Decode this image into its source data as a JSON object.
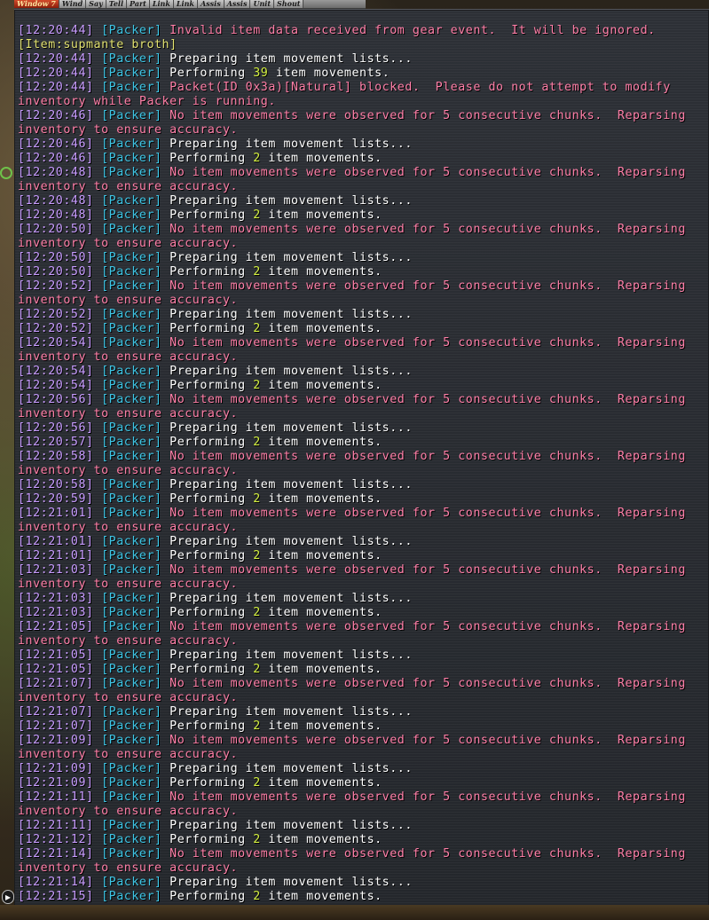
{
  "tabs": [
    "Window 7",
    "Wind",
    "Say",
    "Tell",
    "Part",
    "Link",
    "Link",
    "Assis",
    "Assis",
    "Unit",
    "Shout"
  ],
  "lines": [
    {
      "ts": "[12:20:44]",
      "tag": "[Packer]",
      "parts": [
        {
          "t": " Invalid item data received from gear event.  It will be ignored.",
          "c": "pink"
        }
      ]
    },
    {
      "ts": "",
      "tag": "",
      "parts": [
        {
          "t": "[Item:supmante broth]",
          "c": "item"
        }
      ]
    },
    {
      "ts": "[12:20:44]",
      "tag": "[Packer]",
      "parts": [
        {
          "t": " Preparing item movement lists...",
          "c": "white"
        }
      ]
    },
    {
      "ts": "[12:20:44]",
      "tag": "[Packer]",
      "parts": [
        {
          "t": " Performing ",
          "c": "white"
        },
        {
          "t": "39",
          "c": "num"
        },
        {
          "t": " item movements.",
          "c": "white"
        }
      ]
    },
    {
      "ts": "[12:20:44]",
      "tag": "[Packer]",
      "parts": [
        {
          "t": " Packet(ID 0x3a)[Natural] blocked.  Please do not attempt to modify",
          "c": "pink"
        }
      ]
    },
    {
      "ts": "",
      "tag": "",
      "parts": [
        {
          "t": "inventory while Packer is running.",
          "c": "pink"
        }
      ]
    },
    {
      "ts": "[12:20:46]",
      "tag": "[Packer]",
      "parts": [
        {
          "t": " No item movements were observed for 5 consecutive chunks.  Reparsing",
          "c": "pink"
        }
      ]
    },
    {
      "ts": "",
      "tag": "",
      "parts": [
        {
          "t": "inventory to ensure accuracy.",
          "c": "pink"
        }
      ]
    },
    {
      "ts": "[12:20:46]",
      "tag": "[Packer]",
      "parts": [
        {
          "t": " Preparing item movement lists...",
          "c": "white"
        }
      ]
    },
    {
      "ts": "[12:20:46]",
      "tag": "[Packer]",
      "parts": [
        {
          "t": " Performing ",
          "c": "white"
        },
        {
          "t": "2",
          "c": "num"
        },
        {
          "t": " item movements.",
          "c": "white"
        }
      ]
    },
    {
      "ts": "[12:20:48]",
      "tag": "[Packer]",
      "parts": [
        {
          "t": " No item movements were observed for 5 consecutive chunks.  Reparsing",
          "c": "pink"
        }
      ]
    },
    {
      "ts": "",
      "tag": "",
      "parts": [
        {
          "t": "inventory to ensure accuracy.",
          "c": "pink"
        }
      ]
    },
    {
      "ts": "[12:20:48]",
      "tag": "[Packer]",
      "parts": [
        {
          "t": " Preparing item movement lists...",
          "c": "white"
        }
      ]
    },
    {
      "ts": "[12:20:48]",
      "tag": "[Packer]",
      "parts": [
        {
          "t": " Performing ",
          "c": "white"
        },
        {
          "t": "2",
          "c": "num"
        },
        {
          "t": " item movements.",
          "c": "white"
        }
      ]
    },
    {
      "ts": "[12:20:50]",
      "tag": "[Packer]",
      "parts": [
        {
          "t": " No item movements were observed for 5 consecutive chunks.  Reparsing",
          "c": "pink"
        }
      ]
    },
    {
      "ts": "",
      "tag": "",
      "parts": [
        {
          "t": "inventory to ensure accuracy.",
          "c": "pink"
        }
      ]
    },
    {
      "ts": "[12:20:50]",
      "tag": "[Packer]",
      "parts": [
        {
          "t": " Preparing item movement lists...",
          "c": "white"
        }
      ]
    },
    {
      "ts": "[12:20:50]",
      "tag": "[Packer]",
      "parts": [
        {
          "t": " Performing ",
          "c": "white"
        },
        {
          "t": "2",
          "c": "num"
        },
        {
          "t": " item movements.",
          "c": "white"
        }
      ]
    },
    {
      "ts": "[12:20:52]",
      "tag": "[Packer]",
      "parts": [
        {
          "t": " No item movements were observed for 5 consecutive chunks.  Reparsing",
          "c": "pink"
        }
      ]
    },
    {
      "ts": "",
      "tag": "",
      "parts": [
        {
          "t": "inventory to ensure accuracy.",
          "c": "pink"
        }
      ]
    },
    {
      "ts": "[12:20:52]",
      "tag": "[Packer]",
      "parts": [
        {
          "t": " Preparing item movement lists...",
          "c": "white"
        }
      ]
    },
    {
      "ts": "[12:20:52]",
      "tag": "[Packer]",
      "parts": [
        {
          "t": " Performing ",
          "c": "white"
        },
        {
          "t": "2",
          "c": "num"
        },
        {
          "t": " item movements.",
          "c": "white"
        }
      ]
    },
    {
      "ts": "[12:20:54]",
      "tag": "[Packer]",
      "parts": [
        {
          "t": " No item movements were observed for 5 consecutive chunks.  Reparsing",
          "c": "pink"
        }
      ]
    },
    {
      "ts": "",
      "tag": "",
      "parts": [
        {
          "t": "inventory to ensure accuracy.",
          "c": "pink"
        }
      ]
    },
    {
      "ts": "[12:20:54]",
      "tag": "[Packer]",
      "parts": [
        {
          "t": " Preparing item movement lists...",
          "c": "white"
        }
      ]
    },
    {
      "ts": "[12:20:54]",
      "tag": "[Packer]",
      "parts": [
        {
          "t": " Performing ",
          "c": "white"
        },
        {
          "t": "2",
          "c": "num"
        },
        {
          "t": " item movements.",
          "c": "white"
        }
      ]
    },
    {
      "ts": "[12:20:56]",
      "tag": "[Packer]",
      "parts": [
        {
          "t": " No item movements were observed for 5 consecutive chunks.  Reparsing",
          "c": "pink"
        }
      ]
    },
    {
      "ts": "",
      "tag": "",
      "parts": [
        {
          "t": "inventory to ensure accuracy.",
          "c": "pink"
        }
      ]
    },
    {
      "ts": "[12:20:56]",
      "tag": "[Packer]",
      "parts": [
        {
          "t": " Preparing item movement lists...",
          "c": "white"
        }
      ]
    },
    {
      "ts": "[12:20:57]",
      "tag": "[Packer]",
      "parts": [
        {
          "t": " Performing ",
          "c": "white"
        },
        {
          "t": "2",
          "c": "num"
        },
        {
          "t": " item movements.",
          "c": "white"
        }
      ]
    },
    {
      "ts": "[12:20:58]",
      "tag": "[Packer]",
      "parts": [
        {
          "t": " No item movements were observed for 5 consecutive chunks.  Reparsing",
          "c": "pink"
        }
      ]
    },
    {
      "ts": "",
      "tag": "",
      "parts": [
        {
          "t": "inventory to ensure accuracy.",
          "c": "pink"
        }
      ]
    },
    {
      "ts": "[12:20:58]",
      "tag": "[Packer]",
      "parts": [
        {
          "t": " Preparing item movement lists...",
          "c": "white"
        }
      ]
    },
    {
      "ts": "[12:20:59]",
      "tag": "[Packer]",
      "parts": [
        {
          "t": " Performing ",
          "c": "white"
        },
        {
          "t": "2",
          "c": "num"
        },
        {
          "t": " item movements.",
          "c": "white"
        }
      ]
    },
    {
      "ts": "[12:21:01]",
      "tag": "[Packer]",
      "parts": [
        {
          "t": " No item movements were observed for 5 consecutive chunks.  Reparsing",
          "c": "pink"
        }
      ]
    },
    {
      "ts": "",
      "tag": "",
      "parts": [
        {
          "t": "inventory to ensure accuracy.",
          "c": "pink"
        }
      ]
    },
    {
      "ts": "[12:21:01]",
      "tag": "[Packer]",
      "parts": [
        {
          "t": " Preparing item movement lists...",
          "c": "white"
        }
      ]
    },
    {
      "ts": "[12:21:01]",
      "tag": "[Packer]",
      "parts": [
        {
          "t": " Performing ",
          "c": "white"
        },
        {
          "t": "2",
          "c": "num"
        },
        {
          "t": " item movements.",
          "c": "white"
        }
      ]
    },
    {
      "ts": "[12:21:03]",
      "tag": "[Packer]",
      "parts": [
        {
          "t": " No item movements were observed for 5 consecutive chunks.  Reparsing",
          "c": "pink"
        }
      ]
    },
    {
      "ts": "",
      "tag": "",
      "parts": [
        {
          "t": "inventory to ensure accuracy.",
          "c": "pink"
        }
      ]
    },
    {
      "ts": "[12:21:03]",
      "tag": "[Packer]",
      "parts": [
        {
          "t": " Preparing item movement lists...",
          "c": "white"
        }
      ]
    },
    {
      "ts": "[12:21:03]",
      "tag": "[Packer]",
      "parts": [
        {
          "t": " Performing ",
          "c": "white"
        },
        {
          "t": "2",
          "c": "num"
        },
        {
          "t": " item movements.",
          "c": "white"
        }
      ]
    },
    {
      "ts": "[12:21:05]",
      "tag": "[Packer]",
      "parts": [
        {
          "t": " No item movements were observed for 5 consecutive chunks.  Reparsing",
          "c": "pink"
        }
      ]
    },
    {
      "ts": "",
      "tag": "",
      "parts": [
        {
          "t": "inventory to ensure accuracy.",
          "c": "pink"
        }
      ]
    },
    {
      "ts": "[12:21:05]",
      "tag": "[Packer]",
      "parts": [
        {
          "t": " Preparing item movement lists...",
          "c": "white"
        }
      ]
    },
    {
      "ts": "[12:21:05]",
      "tag": "[Packer]",
      "parts": [
        {
          "t": " Performing ",
          "c": "white"
        },
        {
          "t": "2",
          "c": "num"
        },
        {
          "t": " item movements.",
          "c": "white"
        }
      ]
    },
    {
      "ts": "[12:21:07]",
      "tag": "[Packer]",
      "parts": [
        {
          "t": " No item movements were observed for 5 consecutive chunks.  Reparsing",
          "c": "pink"
        }
      ]
    },
    {
      "ts": "",
      "tag": "",
      "parts": [
        {
          "t": "inventory to ensure accuracy.",
          "c": "pink"
        }
      ]
    },
    {
      "ts": "[12:21:07]",
      "tag": "[Packer]",
      "parts": [
        {
          "t": " Preparing item movement lists...",
          "c": "white"
        }
      ]
    },
    {
      "ts": "[12:21:07]",
      "tag": "[Packer]",
      "parts": [
        {
          "t": " Performing ",
          "c": "white"
        },
        {
          "t": "2",
          "c": "num"
        },
        {
          "t": " item movements.",
          "c": "white"
        }
      ]
    },
    {
      "ts": "[12:21:09]",
      "tag": "[Packer]",
      "parts": [
        {
          "t": " No item movements were observed for 5 consecutive chunks.  Reparsing",
          "c": "pink"
        }
      ]
    },
    {
      "ts": "",
      "tag": "",
      "parts": [
        {
          "t": "inventory to ensure accuracy.",
          "c": "pink"
        }
      ]
    },
    {
      "ts": "[12:21:09]",
      "tag": "[Packer]",
      "parts": [
        {
          "t": " Preparing item movement lists...",
          "c": "white"
        }
      ]
    },
    {
      "ts": "[12:21:09]",
      "tag": "[Packer]",
      "parts": [
        {
          "t": " Performing ",
          "c": "white"
        },
        {
          "t": "2",
          "c": "num"
        },
        {
          "t": " item movements.",
          "c": "white"
        }
      ]
    },
    {
      "ts": "[12:21:11]",
      "tag": "[Packer]",
      "parts": [
        {
          "t": " No item movements were observed for 5 consecutive chunks.  Reparsing",
          "c": "pink"
        }
      ]
    },
    {
      "ts": "",
      "tag": "",
      "parts": [
        {
          "t": "inventory to ensure accuracy.",
          "c": "pink"
        }
      ]
    },
    {
      "ts": "[12:21:11]",
      "tag": "[Packer]",
      "parts": [
        {
          "t": " Preparing item movement lists...",
          "c": "white"
        }
      ]
    },
    {
      "ts": "[12:21:12]",
      "tag": "[Packer]",
      "parts": [
        {
          "t": " Performing ",
          "c": "white"
        },
        {
          "t": "2",
          "c": "num"
        },
        {
          "t": " item movements.",
          "c": "white"
        }
      ]
    },
    {
      "ts": "[12:21:14]",
      "tag": "[Packer]",
      "parts": [
        {
          "t": " No item movements were observed for 5 consecutive chunks.  Reparsing",
          "c": "pink"
        }
      ]
    },
    {
      "ts": "",
      "tag": "",
      "parts": [
        {
          "t": "inventory to ensure accuracy.",
          "c": "pink"
        }
      ]
    },
    {
      "ts": "[12:21:14]",
      "tag": "[Packer]",
      "parts": [
        {
          "t": " Preparing item movement lists...",
          "c": "white"
        }
      ]
    },
    {
      "ts": "[12:21:15]",
      "tag": "[Packer]",
      "parts": [
        {
          "t": " Performing ",
          "c": "white"
        },
        {
          "t": "2",
          "c": "num"
        },
        {
          "t": " item movements.",
          "c": "white"
        }
      ]
    }
  ],
  "icons": {
    "scroll": "scroll-down-arrow-icon",
    "marker": "ring-marker-icon"
  },
  "colors": {
    "timestamp": "#c89cff",
    "tag": "#3ec6e6",
    "warning": "#ff7fa8",
    "info": "#ffffff",
    "number": "#d4f040",
    "item": "#e0e070"
  }
}
